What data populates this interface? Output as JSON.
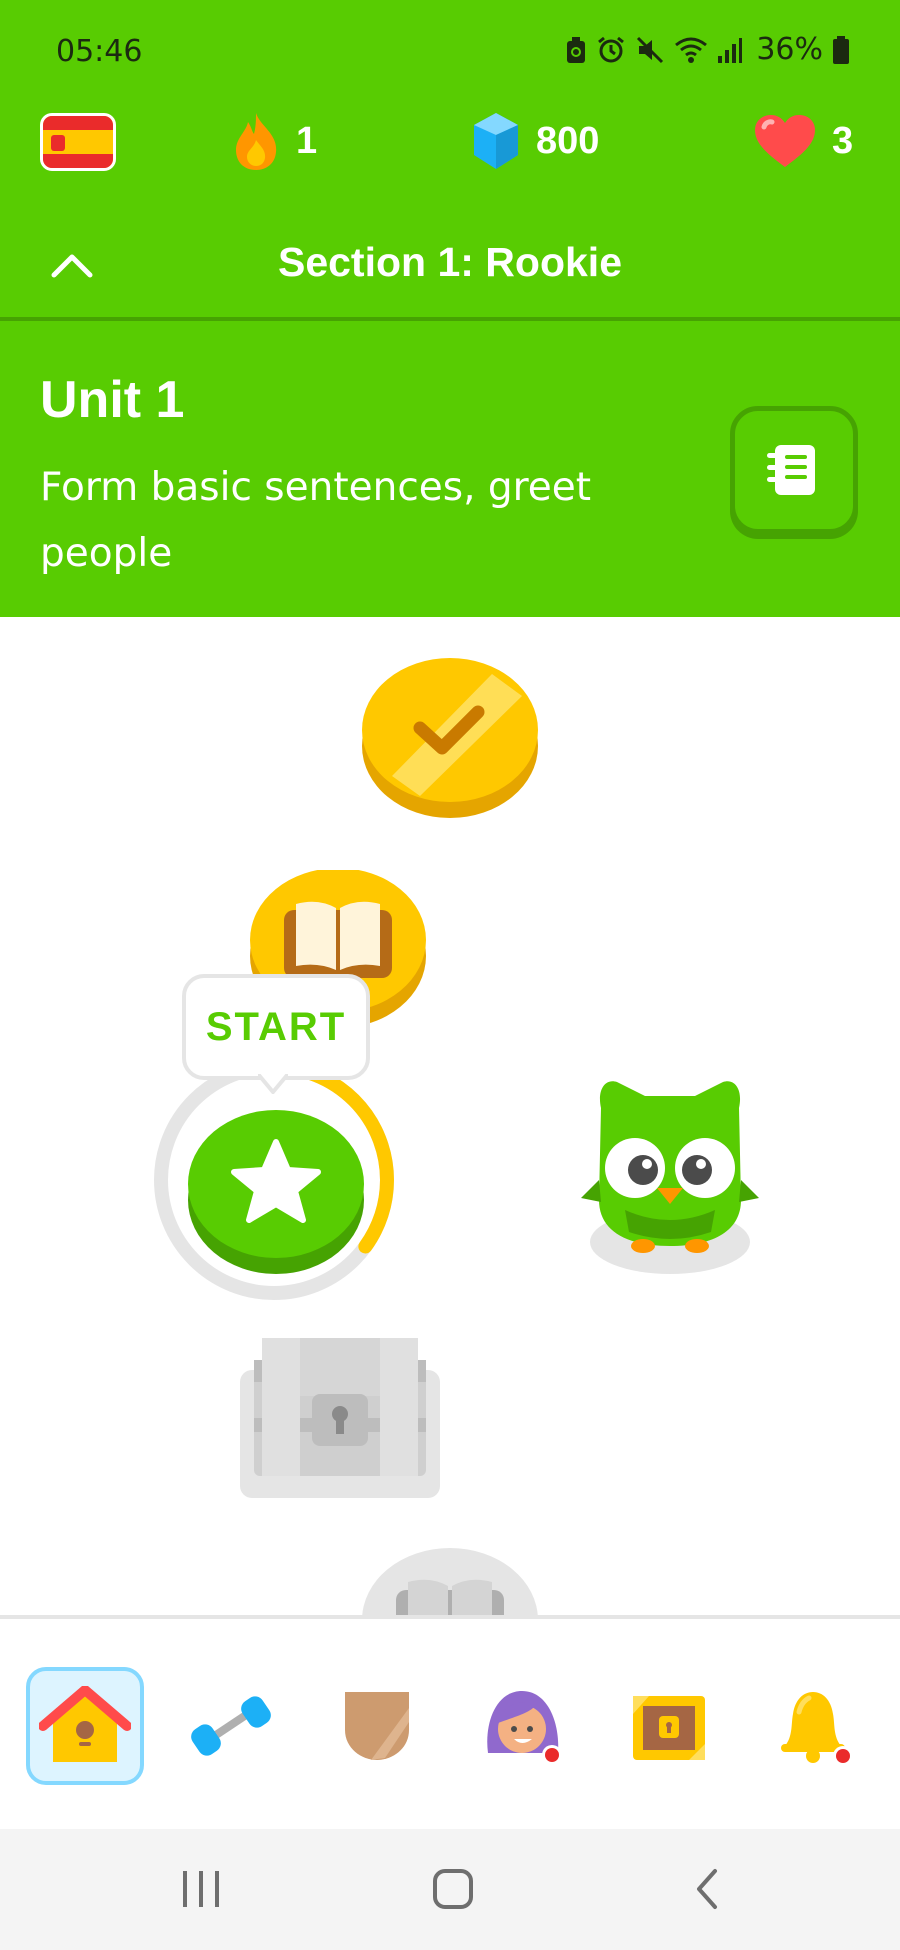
{
  "status_bar": {
    "time": "05:46",
    "battery": "36%",
    "icons": [
      "recycle-badge-icon",
      "alarm-icon",
      "mute-icon",
      "wifi-icon",
      "signal-icon",
      "battery-icon"
    ]
  },
  "stats": {
    "language_flag": "spain-flag-icon",
    "streak": "1",
    "gems": "800",
    "hearts": "3"
  },
  "section": {
    "title": "Section 1: Rookie"
  },
  "unit": {
    "title": "Unit 1",
    "description": "Form basic sentences, greet people"
  },
  "path": {
    "start_label": "START",
    "lesson_progress": 0.35,
    "nodes": [
      "completed-lesson",
      "story-lesson",
      "current-lesson",
      "locked-chest",
      "locked-story"
    ]
  },
  "bottom_nav": {
    "items": [
      "learn",
      "practice",
      "leagues",
      "profile",
      "shop",
      "notifications"
    ],
    "active": "learn"
  },
  "colors": {
    "brand_green": "#58cc02",
    "gold": "#ffc800",
    "blue": "#1cb0f6",
    "heart_red": "#ff4b4b",
    "locked_gray": "#e5e5e5"
  }
}
